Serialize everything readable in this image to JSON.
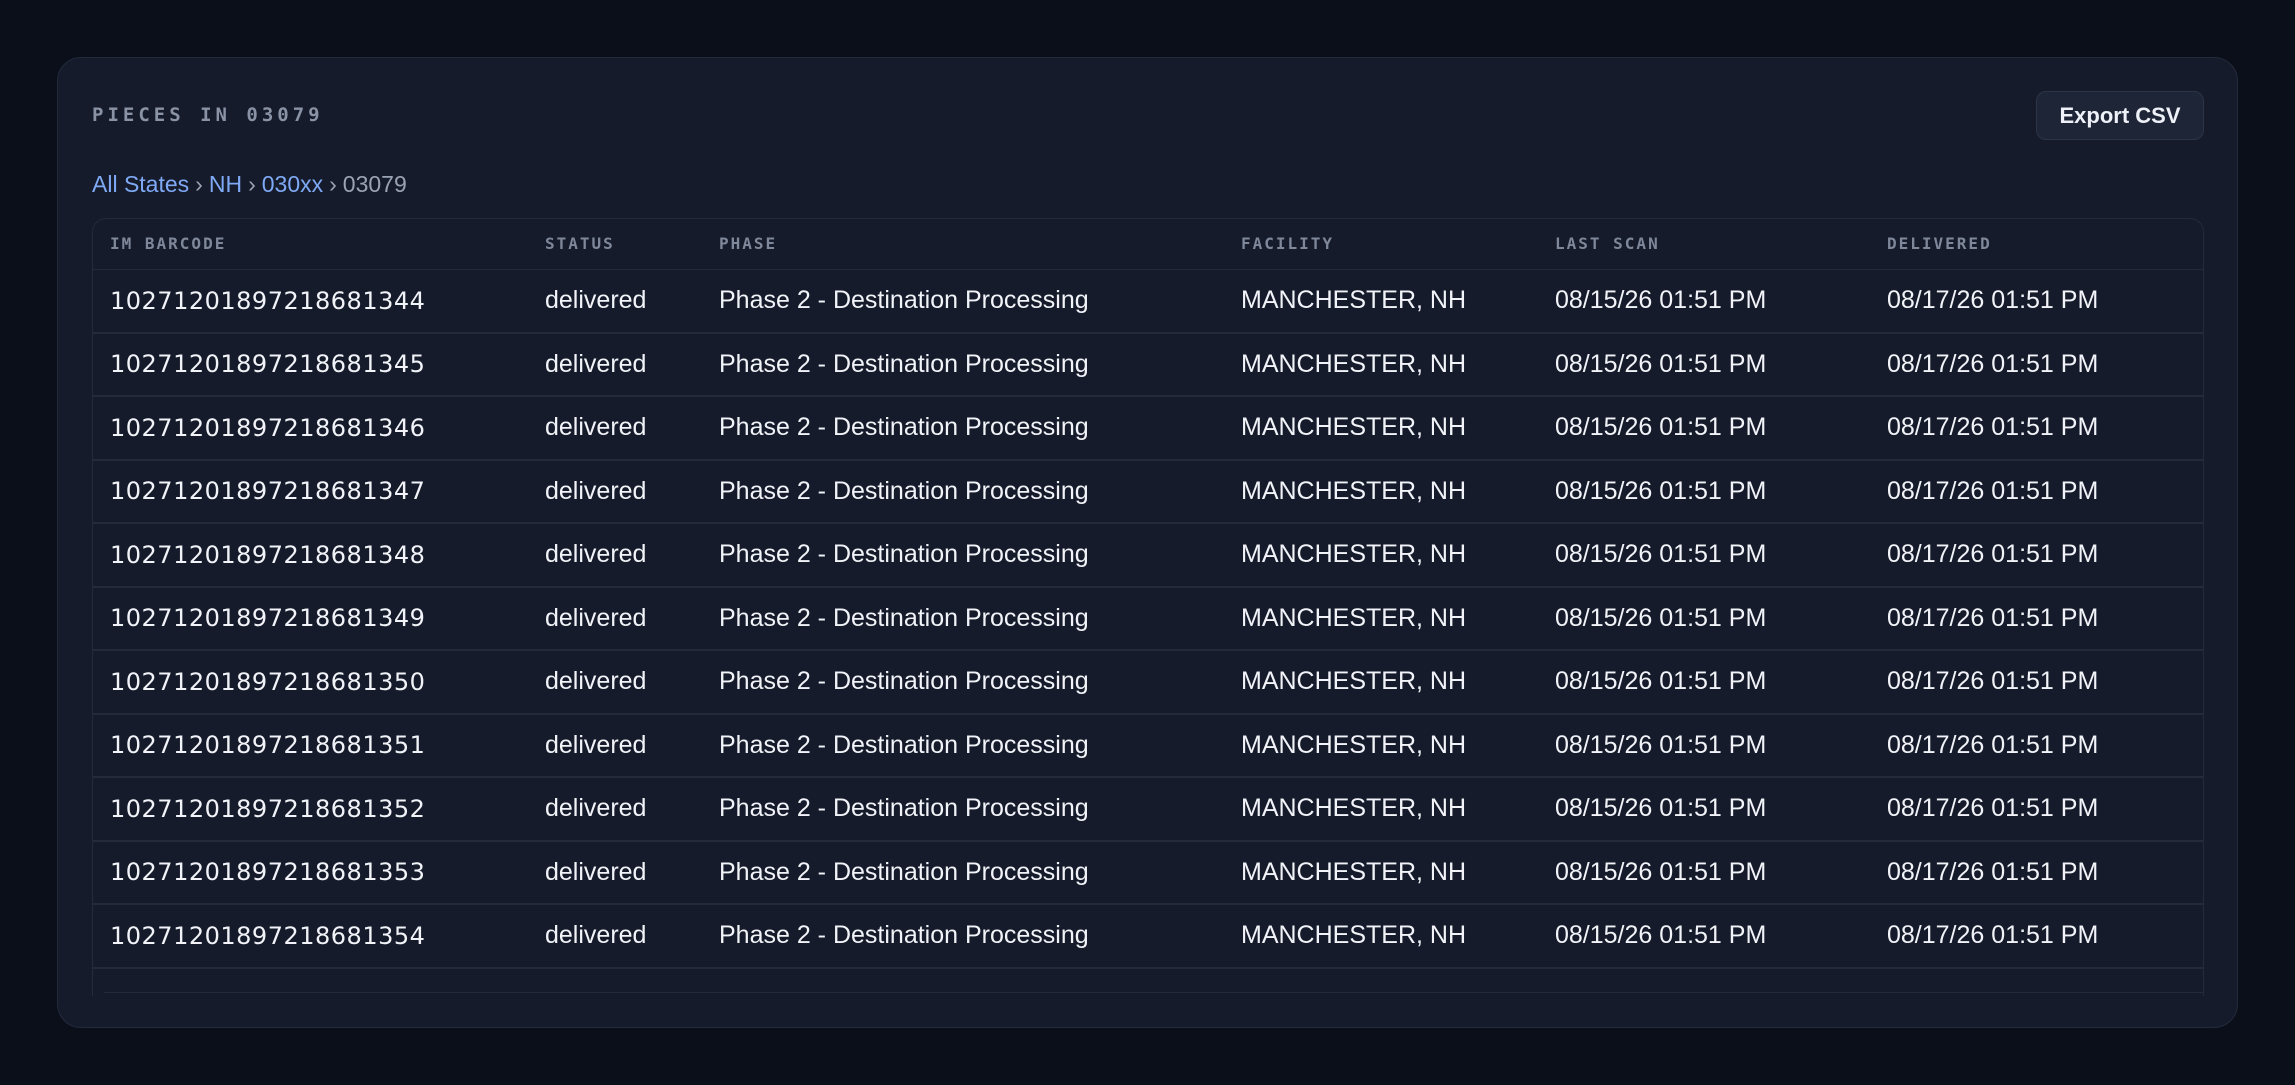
{
  "panel": {
    "title": "PIECES IN 03079",
    "export_label": "Export CSV"
  },
  "breadcrumb": {
    "items": [
      "All States",
      "NH",
      "030xx"
    ],
    "current": "03079",
    "separator": "›"
  },
  "table": {
    "columns": [
      "IM BARCODE",
      "STATUS",
      "PHASE",
      "FACILITY",
      "LAST SCAN",
      "DELIVERED"
    ],
    "rows": [
      [
        "10271201897218681344",
        "delivered",
        "Phase 2 - Destination Processing",
        "MANCHESTER, NH",
        "08/15/26 01:51 PM",
        "08/17/26 01:51 PM"
      ],
      [
        "10271201897218681345",
        "delivered",
        "Phase 2 - Destination Processing",
        "MANCHESTER, NH",
        "08/15/26 01:51 PM",
        "08/17/26 01:51 PM"
      ],
      [
        "10271201897218681346",
        "delivered",
        "Phase 2 - Destination Processing",
        "MANCHESTER, NH",
        "08/15/26 01:51 PM",
        "08/17/26 01:51 PM"
      ],
      [
        "10271201897218681347",
        "delivered",
        "Phase 2 - Destination Processing",
        "MANCHESTER, NH",
        "08/15/26 01:51 PM",
        "08/17/26 01:51 PM"
      ],
      [
        "10271201897218681348",
        "delivered",
        "Phase 2 - Destination Processing",
        "MANCHESTER, NH",
        "08/15/26 01:51 PM",
        "08/17/26 01:51 PM"
      ],
      [
        "10271201897218681349",
        "delivered",
        "Phase 2 - Destination Processing",
        "MANCHESTER, NH",
        "08/15/26 01:51 PM",
        "08/17/26 01:51 PM"
      ],
      [
        "10271201897218681350",
        "delivered",
        "Phase 2 - Destination Processing",
        "MANCHESTER, NH",
        "08/15/26 01:51 PM",
        "08/17/26 01:51 PM"
      ],
      [
        "10271201897218681351",
        "delivered",
        "Phase 2 - Destination Processing",
        "MANCHESTER, NH",
        "08/15/26 01:51 PM",
        "08/17/26 01:51 PM"
      ],
      [
        "10271201897218681352",
        "delivered",
        "Phase 2 - Destination Processing",
        "MANCHESTER, NH",
        "08/15/26 01:51 PM",
        "08/17/26 01:51 PM"
      ],
      [
        "10271201897218681353",
        "delivered",
        "Phase 2 - Destination Processing",
        "MANCHESTER, NH",
        "08/15/26 01:51 PM",
        "08/17/26 01:51 PM"
      ],
      [
        "10271201897218681354",
        "delivered",
        "Phase 2 - Destination Processing",
        "MANCHESTER, NH",
        "08/15/26 01:51 PM",
        "08/17/26 01:51 PM"
      ]
    ]
  },
  "colors": {
    "background": "#0b0f1a",
    "panel": "#151b2a",
    "link": "#7fa9f5",
    "text": "#f1f3f8",
    "muted": "#8a93a6"
  }
}
